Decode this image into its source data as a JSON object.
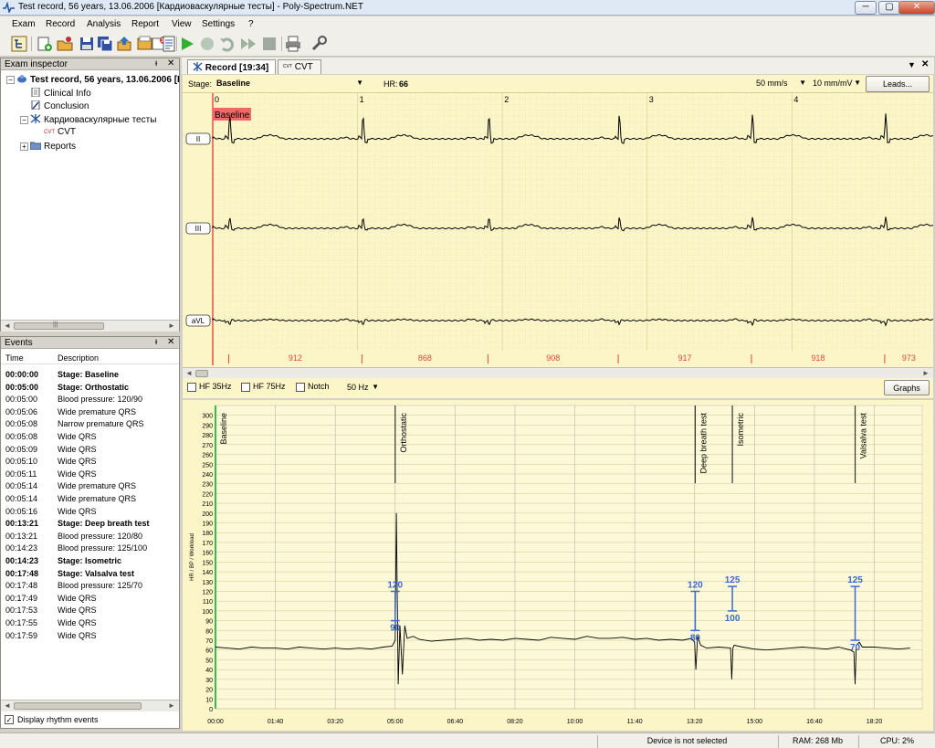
{
  "window": {
    "title": "Test record, 56 years, 13.06.2006 [Кардиоваскулярные тесты] - Poly-Spectrum.NET",
    "min_label": "─",
    "max_label": "▢",
    "close_label": "✕"
  },
  "menu": [
    "Exam",
    "Record",
    "Analysis",
    "Report",
    "View",
    "Settings",
    "?"
  ],
  "toolbar": {
    "icons": [
      "exam-tree-icon",
      "add-exam-icon",
      "open-exam-icon",
      "save-icon",
      "save-all-icon",
      "export-icon",
      "import-icon",
      "delete-icon",
      "protocol-icon",
      "play-icon",
      "record-icon",
      "undo-icon",
      "fast-forward-icon",
      "stop-icon",
      "print-icon",
      "settings-wrench-icon"
    ]
  },
  "inspector": {
    "title": "Exam inspector",
    "pin": "ᵻ",
    "close": "✕",
    "tree": [
      {
        "label": "Test record, 56 years, 13.06.2006 [I",
        "level": 0,
        "bold": true,
        "icon": "patient-icon",
        "expander": "−"
      },
      {
        "label": "Clinical Info",
        "level": 1,
        "bold": false,
        "icon": "document-icon",
        "expander": ""
      },
      {
        "label": "Conclusion",
        "level": 1,
        "bold": false,
        "icon": "edit-document-icon",
        "expander": ""
      },
      {
        "label": "Кардиоваскулярные тесты",
        "level": 1,
        "bold": false,
        "icon": "cardio-test-icon",
        "expander": "−"
      },
      {
        "label": "CVT",
        "level": 2,
        "bold": false,
        "icon": "cvt-icon",
        "icon_text": "CVT",
        "expander": ""
      },
      {
        "label": "Reports",
        "level": 1,
        "bold": false,
        "icon": "folder-icon",
        "expander": "+"
      }
    ],
    "scroll_thumb": "|||"
  },
  "events": {
    "title": "Events",
    "pin": "ᵻ",
    "close": "✕",
    "col_time": "Time",
    "col_desc": "Description",
    "rows": [
      {
        "time": "00:00:00",
        "desc": "Stage: Baseline",
        "bold": true
      },
      {
        "time": "00:05:00",
        "desc": "Stage: Orthostatic",
        "bold": true
      },
      {
        "time": "00:05:00",
        "desc": "Blood pressure: 120/90",
        "bold": false
      },
      {
        "time": "00:05:06",
        "desc": "Wide premature QRS",
        "bold": false
      },
      {
        "time": "00:05:08",
        "desc": "Narrow premature QRS",
        "bold": false
      },
      {
        "time": "00:05:08",
        "desc": "Wide QRS",
        "bold": false
      },
      {
        "time": "00:05:09",
        "desc": "Wide QRS",
        "bold": false
      },
      {
        "time": "00:05:10",
        "desc": "Wide QRS",
        "bold": false
      },
      {
        "time": "00:05:11",
        "desc": "Wide QRS",
        "bold": false
      },
      {
        "time": "00:05:14",
        "desc": "Wide premature QRS",
        "bold": false
      },
      {
        "time": "00:05:14",
        "desc": "Wide premature QRS",
        "bold": false
      },
      {
        "time": "00:05:16",
        "desc": "Wide QRS",
        "bold": false
      },
      {
        "time": "00:13:21",
        "desc": "Stage: Deep breath test",
        "bold": true
      },
      {
        "time": "00:13:21",
        "desc": "Blood pressure: 120/80",
        "bold": false
      },
      {
        "time": "00:14:23",
        "desc": "Blood pressure: 125/100",
        "bold": false
      },
      {
        "time": "00:14:23",
        "desc": "Stage: Isometric",
        "bold": true
      },
      {
        "time": "00:17:48",
        "desc": "Stage: Valsalva test",
        "bold": true
      },
      {
        "time": "00:17:48",
        "desc": "Blood pressure: 125/70",
        "bold": false
      },
      {
        "time": "00:17:49",
        "desc": "Wide QRS",
        "bold": false
      },
      {
        "time": "00:17:53",
        "desc": "Wide QRS",
        "bold": false
      },
      {
        "time": "00:17:55",
        "desc": "Wide QRS",
        "bold": false
      },
      {
        "time": "00:17:59",
        "desc": "Wide QRS",
        "bold": false
      }
    ],
    "display_rhythm_label": "Display rhythm events",
    "display_rhythm_checked": "✓"
  },
  "tabs": [
    {
      "label": "Record [19:34]",
      "active": true,
      "icon": "record-tab-icon"
    },
    {
      "label": "CVT",
      "active": false,
      "icon": "cvt-tab-icon",
      "icon_text": "CVT"
    }
  ],
  "tab_controls": {
    "menu": "▼",
    "close": "✕"
  },
  "ecg": {
    "stage_label": "Stage:",
    "stage_value": "Baseline",
    "hr_label": "HR:",
    "hr_value": "66",
    "speed": "50 mm/s",
    "gain": "10 mm/mV",
    "leads_button": "Leads...",
    "baseline_marker": "Baseline",
    "second_ticks": [
      "0",
      "1",
      "2",
      "3",
      "4"
    ],
    "leads": [
      "II",
      "III",
      "aVL"
    ],
    "rr_intervals": [
      "912",
      "868",
      "908",
      "917",
      "918",
      "973"
    ],
    "beat_positions_s": [
      0.11,
      1.03,
      1.9,
      2.8,
      3.72,
      4.64
    ],
    "colors": {
      "background": "#fbf5c8",
      "grid": "#e6dc98",
      "marker": "#e8504a",
      "rr": "#e04840",
      "trace": "#000000"
    }
  },
  "filters": {
    "hf35": "HF 35Hz",
    "hf75": "HF 75Hz",
    "notch": "Notch",
    "mains": "50 Hz",
    "graphs_button": "Graphs"
  },
  "chart_data": {
    "type": "line",
    "title": "",
    "xlabel": "",
    "ylabel": "HR / BP / Workload",
    "xlim": [
      0,
      1180
    ],
    "ylim": [
      0,
      310
    ],
    "y_ticks": [
      0,
      10,
      20,
      30,
      40,
      50,
      60,
      70,
      80,
      90,
      100,
      110,
      120,
      130,
      140,
      150,
      160,
      170,
      180,
      190,
      200,
      210,
      220,
      230,
      240,
      250,
      260,
      270,
      280,
      290,
      300
    ],
    "x_ticks": [
      {
        "t": 0,
        "label": "00:00"
      },
      {
        "t": 100,
        "label": "01:40"
      },
      {
        "t": 200,
        "label": "03:20"
      },
      {
        "t": 300,
        "label": "05:00"
      },
      {
        "t": 400,
        "label": "06:40"
      },
      {
        "t": 500,
        "label": "08:20"
      },
      {
        "t": 600,
        "label": "10:00"
      },
      {
        "t": 700,
        "label": "11:40"
      },
      {
        "t": 800,
        "label": "13:20"
      },
      {
        "t": 900,
        "label": "15:00"
      },
      {
        "t": 1000,
        "label": "16:40"
      },
      {
        "t": 1100,
        "label": "18:20"
      }
    ],
    "stages": [
      {
        "t": 0,
        "label": "Baseline"
      },
      {
        "t": 300,
        "label": "Orthostatic"
      },
      {
        "t": 801,
        "label": "Deep breath test"
      },
      {
        "t": 863,
        "label": "Isometric"
      },
      {
        "t": 1068,
        "label": "Valsalva test"
      }
    ],
    "bp": [
      {
        "t": 300,
        "sys": 120,
        "dia": 90
      },
      {
        "t": 801,
        "sys": 120,
        "dia": 80
      },
      {
        "t": 863,
        "sys": 125,
        "dia": 100
      },
      {
        "t": 1068,
        "sys": 125,
        "dia": 70
      }
    ],
    "series": [
      {
        "x": [
          0,
          20,
          40,
          60,
          80,
          100,
          120,
          140,
          160,
          180,
          200,
          220,
          240,
          260,
          280,
          295,
          300,
          302,
          305,
          308,
          312,
          316,
          320,
          330,
          340,
          360,
          380,
          400,
          420,
          440,
          460,
          480,
          500,
          520,
          540,
          560,
          580,
          600,
          620,
          640,
          660,
          680,
          700,
          720,
          740,
          760,
          780,
          795,
          800,
          802,
          805,
          810,
          820,
          840,
          860,
          862,
          864,
          866,
          880,
          900,
          920,
          940,
          960,
          980,
          1000,
          1020,
          1040,
          1060,
          1066,
          1068,
          1070,
          1075,
          1080,
          1100,
          1120,
          1140,
          1160
        ],
        "values": [
          63,
          62,
          61,
          63,
          62,
          62,
          61,
          63,
          62,
          61,
          62,
          61,
          62,
          61,
          63,
          64,
          70,
          200,
          25,
          85,
          35,
          85,
          72,
          74,
          71,
          69,
          70,
          71,
          72,
          70,
          71,
          70,
          72,
          71,
          70,
          73,
          72,
          71,
          74,
          72,
          72,
          73,
          71,
          72,
          70,
          71,
          70,
          72,
          68,
          40,
          74,
          65,
          62,
          63,
          62,
          30,
          62,
          65,
          63,
          61,
          60,
          61,
          62,
          63,
          62,
          61,
          63,
          60,
          58,
          25,
          65,
          68,
          63,
          63,
          62,
          61,
          62
        ]
      }
    ],
    "legend": "none",
    "grid": true
  }
}
